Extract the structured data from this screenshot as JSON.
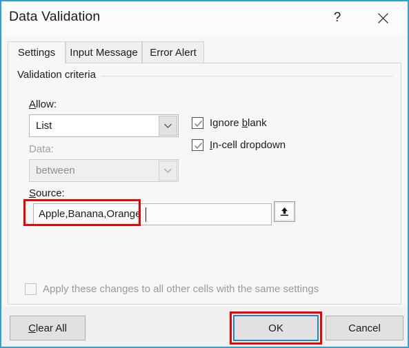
{
  "dialog": {
    "title": "Data Validation",
    "help_label": "?",
    "close_label": "close-icon",
    "border_color": "#2f9fdc"
  },
  "tabs": [
    {
      "label": "Settings",
      "active": true
    },
    {
      "label": "Input Message",
      "active": false
    },
    {
      "label": "Error Alert",
      "active": false
    }
  ],
  "settings": {
    "group_label": "Validation criteria",
    "allow": {
      "label_prefix": "",
      "label_accel": "A",
      "label_suffix": "llow:",
      "value": "List",
      "enabled": true
    },
    "data": {
      "label": "Data:",
      "value": "between",
      "enabled": false
    },
    "source": {
      "label_accel": "S",
      "label_suffix": "ource:",
      "value": "Apple,Banana,Orange",
      "range_button_icon": "range-select-icon"
    },
    "ignore_blank": {
      "prefix": "Ignore ",
      "accel": "b",
      "suffix": "lank",
      "checked": true,
      "enabled": true
    },
    "in_cell_dropdown": {
      "prefix": "",
      "accel": "I",
      "suffix": "n-cell dropdown",
      "checked": true,
      "enabled": true
    },
    "apply_all": {
      "label": "Apply these changes to all other cells with the same settings",
      "checked": false,
      "enabled": false
    }
  },
  "footer": {
    "clear_all": {
      "accel": "C",
      "suffix": "lear All"
    },
    "ok": "OK",
    "cancel": "Cancel"
  },
  "highlights": {
    "color": "#ee0000",
    "targets": [
      "source-input",
      "ok-button"
    ]
  }
}
